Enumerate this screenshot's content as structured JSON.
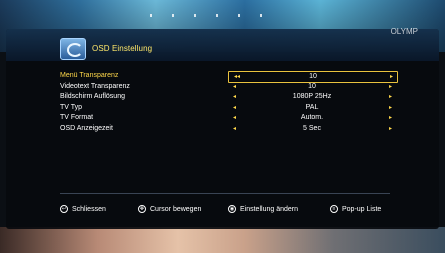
{
  "header": {
    "title": "OSD Einstellung",
    "watermark": "OLYMP"
  },
  "settings": [
    {
      "label": "Menü Transparenz",
      "value": "10",
      "active": true,
      "left_arrow": "◂◂",
      "right_arrow": "▸"
    },
    {
      "label": "Videotext Transparenz",
      "value": "10",
      "active": false,
      "left_arrow": "◂",
      "right_arrow": "▸"
    },
    {
      "label": "Bildschirm Auflösung",
      "value": "1080P 25Hz",
      "active": false,
      "left_arrow": "◂",
      "right_arrow": "▸"
    },
    {
      "label": "TV Typ",
      "value": "PAL",
      "active": false,
      "left_arrow": "◂",
      "right_arrow": "▸"
    },
    {
      "label": "TV Format",
      "value": "Autom.",
      "active": false,
      "left_arrow": "◂",
      "right_arrow": "▸"
    },
    {
      "label": "OSD Anzeigezeit",
      "value": "5 Sec",
      "active": false,
      "left_arrow": "◂",
      "right_arrow": "▸"
    }
  ],
  "hints": [
    {
      "icon": "exit-icon",
      "glyph": "↩",
      "label": "Schliessen"
    },
    {
      "icon": "cursor-icon",
      "glyph": "✥",
      "label": "Cursor bewegen"
    },
    {
      "icon": "ok-icon",
      "glyph": "◉",
      "label": "Einstellung ändern"
    },
    {
      "icon": "menu-icon",
      "glyph": "≡",
      "label": "Pop-up Liste"
    }
  ],
  "colors": {
    "highlight": "#ffd84a",
    "text": "#ffffff",
    "panel": "#080a0e"
  }
}
